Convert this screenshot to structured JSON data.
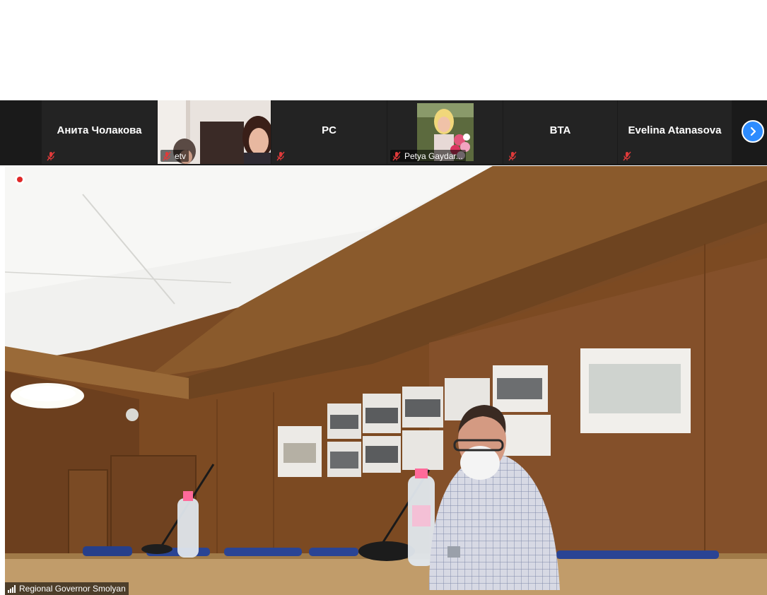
{
  "participants": [
    {
      "name": "Анита Чолакова",
      "type": "avatar"
    },
    {
      "name": "etv",
      "type": "video"
    },
    {
      "name": "PC",
      "type": "avatar"
    },
    {
      "name": "Petya Gaydar...",
      "type": "video"
    },
    {
      "name": "BTA",
      "type": "avatar"
    },
    {
      "name": "Evelina Atanasova",
      "type": "avatar"
    }
  ],
  "strip": {
    "next_icon": "chevron-right-icon"
  },
  "main_video": {
    "speaker_label": "Regional Governor Smolyan",
    "recording_icon": "recording-dot-icon",
    "signal_icon": "signal-bars-icon"
  },
  "colors": {
    "strip_bg": "#1a1a1a",
    "tile_bg": "#232323",
    "accent_blue": "#2d8cff",
    "mute_red": "#e03a3a"
  }
}
